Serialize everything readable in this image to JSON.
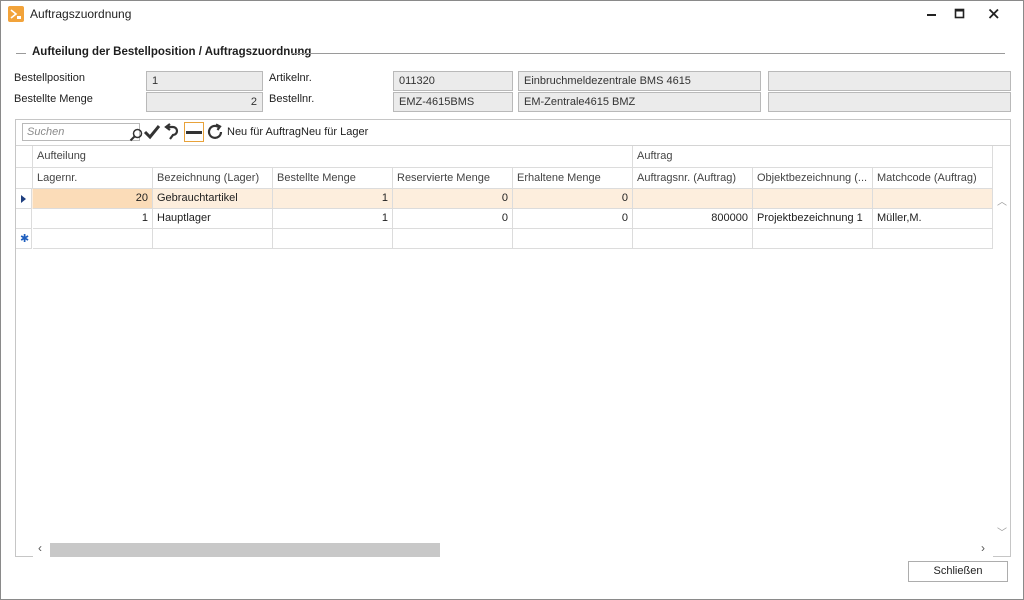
{
  "window": {
    "title": "Auftragszuordnung"
  },
  "group": {
    "title": "Aufteilung der Bestellposition / Auftragszuordnung"
  },
  "form": {
    "bestellposition_label": "Bestellposition",
    "bestellposition_value": "1",
    "bestellte_menge_label": "Bestellte Menge",
    "bestellte_menge_value": "2",
    "artikelnr_label": "Artikelnr.",
    "artikelnr_value": "011320",
    "artikel_bezeichnung": "Einbruchmeldezentrale BMS 4615",
    "artikel_extra": "",
    "bestellnr_label": "Bestellnr.",
    "bestellnr_value": "EMZ-4615BMS",
    "bestellnr_bezeichnung": "EM-Zentrale4615 BMZ",
    "bestellnr_extra": ""
  },
  "toolbar": {
    "search_placeholder": "Suchen",
    "new_for_order_label": "Neu für Auftrag",
    "new_for_stock_label": "Neu für Lager"
  },
  "grid": {
    "bands": [
      "Aufteilung",
      "Auftrag"
    ],
    "columns": [
      "Lagernr.",
      "Bezeichnung (Lager)",
      "Bestellte Menge",
      "Reservierte Menge",
      "Erhaltene Menge",
      "Auftragsnr. (Auftrag)",
      "Objektbezeichnung (...",
      "Matchcode (Auftrag)"
    ],
    "rows": [
      [
        "20",
        "Gebrauchtartikel",
        "1",
        "0",
        "0",
        "",
        "",
        ""
      ],
      [
        "1",
        "Hauptlager",
        "1",
        "0",
        "0",
        "800000",
        "Projektbezeichnung 1",
        "Müller,M."
      ]
    ]
  },
  "footer": {
    "close_label": "Schließen"
  },
  "colors": {
    "selected_row": "#fdeedd",
    "selected_cell": "#fbdcb8",
    "accent": "#f2a33a"
  },
  "icons": [
    "app-icon",
    "minimize-icon",
    "maximize-icon",
    "close-icon",
    "search-icon",
    "check-icon",
    "undo-icon",
    "minus-icon",
    "refresh-icon",
    "row-pointer-icon",
    "new-row-icon"
  ]
}
